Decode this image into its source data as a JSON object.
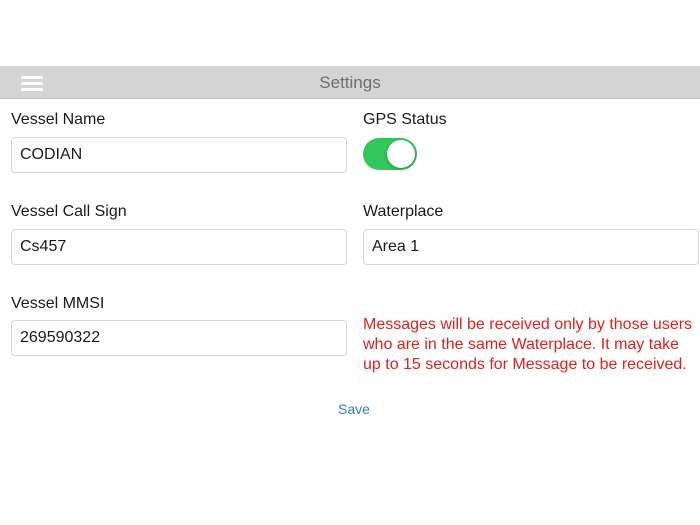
{
  "nav": {
    "title": "Settings",
    "menu_icon": "hamburger-menu-icon"
  },
  "form": {
    "vessel_name": {
      "label": "Vessel Name",
      "value": "CODIAN"
    },
    "gps_status": {
      "label": "GPS Status",
      "enabled": true
    },
    "vessel_call_sign": {
      "label": "Vessel Call Sign",
      "value": "Cs457"
    },
    "waterplace": {
      "label": "Waterplace",
      "value": "Area 1"
    },
    "vessel_mmsi": {
      "label": "Vessel MMSI",
      "value": "269590322"
    },
    "notice": "Messages will be received only by those users who are in the same Waterplace. It may take up to 15 seconds for Message to be received.",
    "save_label": "Save"
  },
  "colors": {
    "nav_background": "#d4d4d4",
    "toggle_on": "#34c759",
    "notice_text": "#e0201b",
    "link": "#2f7fd0"
  }
}
